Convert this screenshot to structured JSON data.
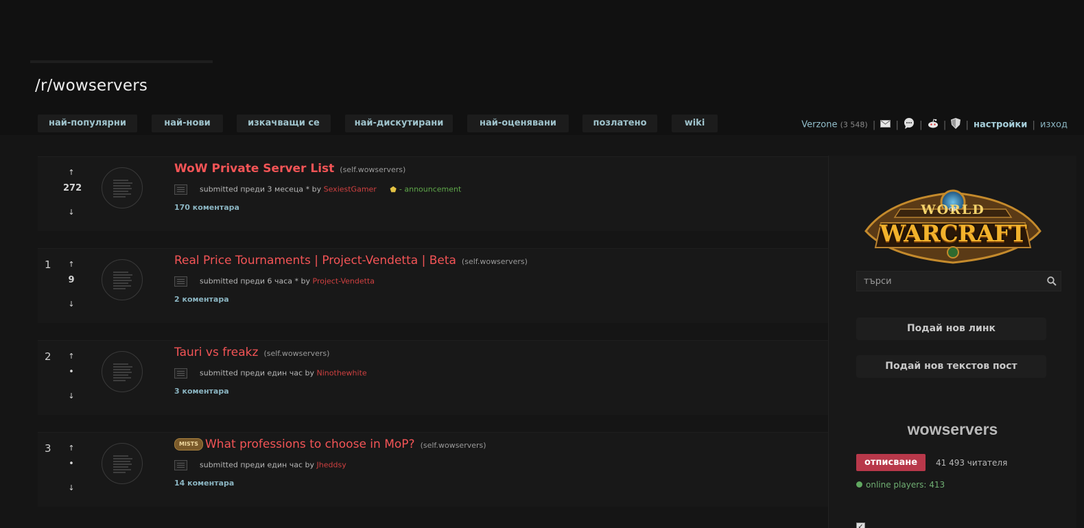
{
  "header": {
    "subreddit_title": "/r/wowservers",
    "tabs": [
      "най-популярни",
      "най-нови",
      "изкачващи се",
      "най-дискутирани",
      "най-оценявани",
      "позлатено",
      "wiki"
    ]
  },
  "userbar": {
    "username": "Verzone",
    "karma": "(3 548)",
    "preferences_label": "настройки",
    "logout_label": "изход",
    "separator": "|"
  },
  "posts": [
    {
      "rank": "",
      "score": "272",
      "title": "WoW Private Server List",
      "domain": "(self.wowservers)",
      "meta_prefix": "submitted преди 3 месеца * by",
      "author": "SexiestGamer",
      "distinguished": "- announcement",
      "comments": "170 коментара"
    },
    {
      "rank": "1",
      "score": "9",
      "title": "Real Price Tournaments | Project-Vendetta | Beta",
      "domain": "(self.wowservers)",
      "meta_prefix": "submitted преди 6 часа * by",
      "author": "Project-Vendetta",
      "comments": "2 коментара"
    },
    {
      "rank": "2",
      "score": "•",
      "title": "Tauri vs freakz",
      "domain": "(self.wowservers)",
      "meta_prefix": "submitted преди един час by",
      "author": "Ninothewhite",
      "comments": "3 коментара"
    },
    {
      "rank": "3",
      "score": "•",
      "flair": "MISTS",
      "title": "What professions to choose in MoP?",
      "domain": "(self.wowservers)",
      "meta_prefix": "submitted преди един час by",
      "author": "Jheddsy",
      "comments": "14 коментара"
    }
  ],
  "vote": {
    "up": "↑",
    "down": "↓"
  },
  "sidebar": {
    "logo_line1": "WORLD",
    "logo_of": "OF",
    "logo_line2": "WARCRAFT",
    "search_placeholder": "търси",
    "submit_link_label": "Подай нов линк",
    "submit_text_label": "Подай нов текстов пост",
    "subreddit_name": "wowservers",
    "unsubscribe_label": "отписване",
    "readers": "41 493 читателя",
    "online": "online players: 413"
  },
  "colors": {
    "accent_title": "#f35456",
    "link_blue": "#8bb5c2",
    "unsubscribe": "#b8384a",
    "online_green": "#6fae72"
  },
  "icons": [
    "mail-icon",
    "chat-icon",
    "reddit-alien-icon",
    "shield-icon",
    "search-icon",
    "self-post-icon",
    "announcement-star-icon"
  ]
}
